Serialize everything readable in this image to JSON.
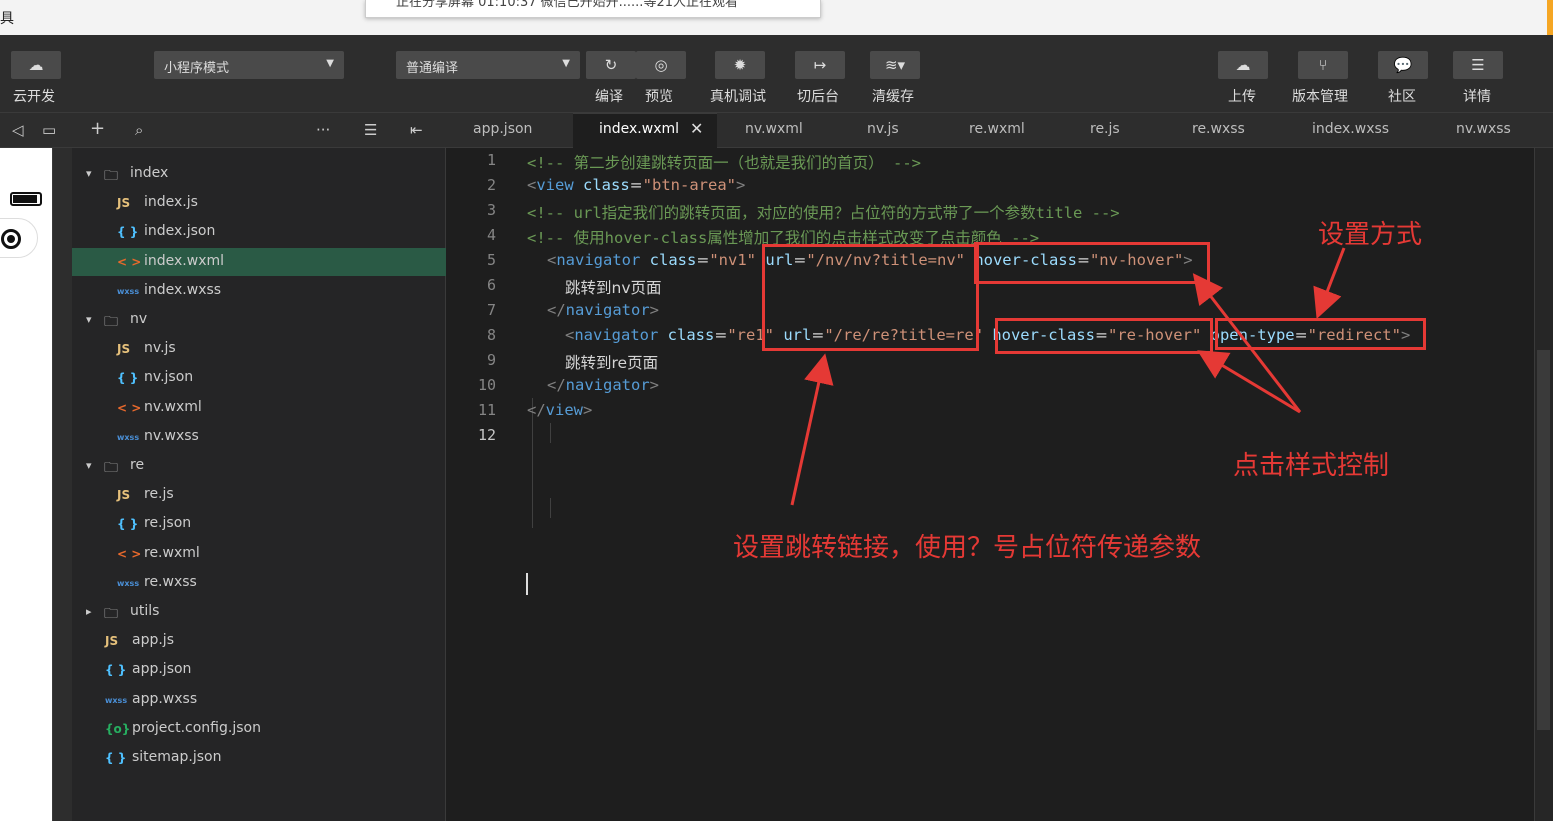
{
  "window": {
    "partial_title_char": "具",
    "notification_partial": "正在分享屏幕   01:10:37    微信已开始开......等21人正在观看"
  },
  "toolbar": {
    "cloud_label": "云开发",
    "mode_dropdown": "小程序模式",
    "compile_dropdown": "普通编译",
    "compile_label": "编译",
    "preview_label": "预览",
    "debug_label": "真机调试",
    "background_label": "切后台",
    "clear_cache_label": "清缓存",
    "upload_label": "上传",
    "version_label": "版本管理",
    "community_label": "社区",
    "details_label": "详情"
  },
  "tabs": [
    "app.json",
    "index.wxml",
    "nv.wxml",
    "nv.js",
    "re.wxml",
    "re.js",
    "re.wxss",
    "index.wxss",
    "nv.wxss"
  ],
  "active_tab": "index.wxml",
  "explorer": {
    "rows": [
      {
        "label": "index",
        "type": "folder",
        "icon": "▾"
      },
      {
        "label": "index.js",
        "type": "js",
        "icon": "JS"
      },
      {
        "label": "index.json",
        "type": "json",
        "icon": "{ }"
      },
      {
        "label": "index.wxml",
        "type": "wxml",
        "icon": "< >"
      },
      {
        "label": "index.wxss",
        "type": "wxss",
        "icon": "wxss"
      },
      {
        "label": "nv",
        "type": "folder",
        "icon": "▾"
      },
      {
        "label": "nv.js",
        "type": "js",
        "icon": "JS"
      },
      {
        "label": "nv.json",
        "type": "json",
        "icon": "{ }"
      },
      {
        "label": "nv.wxml",
        "type": "wxml",
        "icon": "< >"
      },
      {
        "label": "nv.wxss",
        "type": "wxss",
        "icon": "wxss"
      },
      {
        "label": "re",
        "type": "folder",
        "icon": "▾"
      },
      {
        "label": "re.js",
        "type": "js",
        "icon": "JS"
      },
      {
        "label": "re.json",
        "type": "json",
        "icon": "{ }"
      },
      {
        "label": "re.wxml",
        "type": "wxml",
        "icon": "< >"
      },
      {
        "label": "re.wxss",
        "type": "wxss",
        "icon": "wxss"
      },
      {
        "label": "utils",
        "type": "folder",
        "icon": "▸"
      },
      {
        "label": "app.js",
        "type": "js",
        "icon": "JS"
      },
      {
        "label": "app.json",
        "type": "json",
        "icon": "{ }"
      },
      {
        "label": "app.wxss",
        "type": "wxss",
        "icon": "wxss"
      },
      {
        "label": "project.config.json",
        "type": "config",
        "icon": "{o}"
      },
      {
        "label": "sitemap.json",
        "type": "json",
        "icon": "{ }"
      }
    ]
  },
  "code": {
    "line_numbers": [
      "1",
      "2",
      "3",
      "4",
      "5",
      "6",
      "7",
      "8",
      "9",
      "10",
      "11",
      "12"
    ],
    "l1_comment": "<!-- 第二步创建跳转页面一（也就是我们的首页） -->",
    "l2_lt": "<",
    "l2_tag": "view",
    "l2_attr": " class",
    "l2_eq": "=",
    "l2_val": "\"btn-area\"",
    "l2_gt": ">",
    "l3_comment": "<!-- url指定我们的跳转页面，对应的使用？占位符的方式带了一个参数title -->",
    "l4_comment": "<!-- 使用hover-class属性增加了我们的点击样式改变了点击颜色 -->",
    "l5": [
      {
        "t": "<",
        "c": "c-punc"
      },
      {
        "t": "navigator",
        "c": "c-tag"
      },
      {
        "t": " class",
        "c": "c-attr"
      },
      {
        "t": "=",
        "c": "c-text"
      },
      {
        "t": "\"nv1\"",
        "c": "c-str"
      },
      {
        "t": " url",
        "c": "c-attr"
      },
      {
        "t": "=",
        "c": "c-text"
      },
      {
        "t": "\"/nv/nv?title=nv\"",
        "c": "c-str"
      },
      {
        "t": " hover-class",
        "c": "c-attr"
      },
      {
        "t": "=",
        "c": "c-text"
      },
      {
        "t": "\"nv-hover\"",
        "c": "c-str"
      },
      {
        "t": ">",
        "c": "c-punc"
      }
    ],
    "l6_text": "跳转到nv页面",
    "l7": [
      {
        "t": "</",
        "c": "c-punc"
      },
      {
        "t": "navigator",
        "c": "c-tag"
      },
      {
        "t": ">",
        "c": "c-punc"
      }
    ],
    "l8": [
      {
        "t": "<",
        "c": "c-punc"
      },
      {
        "t": "navigator",
        "c": "c-tag"
      },
      {
        "t": " class",
        "c": "c-attr"
      },
      {
        "t": "=",
        "c": "c-text"
      },
      {
        "t": "\"re1\"",
        "c": "c-str"
      },
      {
        "t": " url",
        "c": "c-attr"
      },
      {
        "t": "=",
        "c": "c-text"
      },
      {
        "t": "\"/re/re?title=re\"",
        "c": "c-str"
      },
      {
        "t": " hover-class",
        "c": "c-attr"
      },
      {
        "t": "=",
        "c": "c-text"
      },
      {
        "t": "\"re-hover\"",
        "c": "c-str"
      },
      {
        "t": " open-type",
        "c": "c-attr"
      },
      {
        "t": "=",
        "c": "c-text"
      },
      {
        "t": "\"redirect\"",
        "c": "c-str"
      },
      {
        "t": ">",
        "c": "c-punc"
      }
    ],
    "l9_text": "跳转到re页面",
    "l10": [
      {
        "t": "</",
        "c": "c-punc"
      },
      {
        "t": "navigator",
        "c": "c-tag"
      },
      {
        "t": ">",
        "c": "c-punc"
      }
    ],
    "l11": [
      {
        "t": "</",
        "c": "c-punc"
      },
      {
        "t": "view",
        "c": "c-tag"
      },
      {
        "t": ">",
        "c": "c-punc"
      }
    ]
  },
  "annotations": {
    "set_method": "设置方式",
    "click_style": "点击样式控制",
    "set_link": "设置跳转链接，使用？号占位符传递参数"
  },
  "colors": {
    "annotation": "#e53935",
    "selected_row": "#2a5a45",
    "editor_bg": "#1e1e1e"
  }
}
